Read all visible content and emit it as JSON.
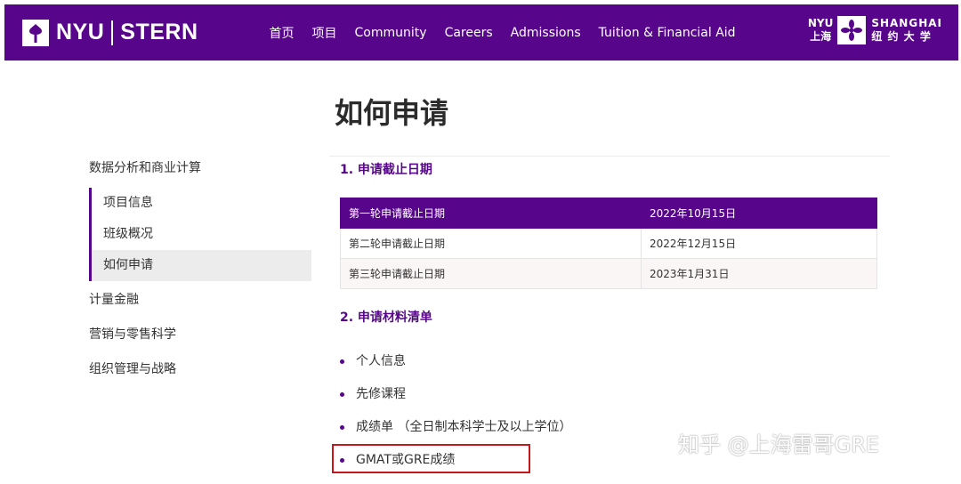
{
  "header": {
    "logo_left": "NYU",
    "logo_right": "STERN",
    "nav": [
      "首页",
      "项目",
      "Community",
      "Careers",
      "Admissions",
      "Tuition & Financial Aid"
    ],
    "shanghai": {
      "nyu": "NYU",
      "city_cn": "上海",
      "shanghai_en": "SHANGHAI",
      "name_cn": "纽 约 大 学"
    }
  },
  "page_title": "如何申请",
  "sidebar": {
    "top": "数据分析和商业计算",
    "sub_items": [
      {
        "label": "项目信息",
        "active": false
      },
      {
        "label": "班级概况",
        "active": false
      },
      {
        "label": "如何申请",
        "active": true
      }
    ],
    "items": [
      "计量金融",
      "营销与零售科学",
      "组织管理与战略"
    ]
  },
  "section1": {
    "title": "1. 申请截止日期",
    "rows": [
      [
        "第一轮申请截止日期",
        "2022年10月15日"
      ],
      [
        "第二轮申请截止日期",
        "2022年12月15日"
      ],
      [
        "第三轮申请截止日期",
        "2023年1月31日"
      ]
    ]
  },
  "section2": {
    "title": "2. 申请材料清单",
    "items": [
      "个人信息",
      "先修课程",
      "成绩单 （全日制本科学士及以上学位）",
      "GMAT或GRE成绩"
    ]
  },
  "watermark": "知乎 @上海雷哥GRE",
  "colors": {
    "brand": "#57068c",
    "highlight": "#c8161d"
  }
}
